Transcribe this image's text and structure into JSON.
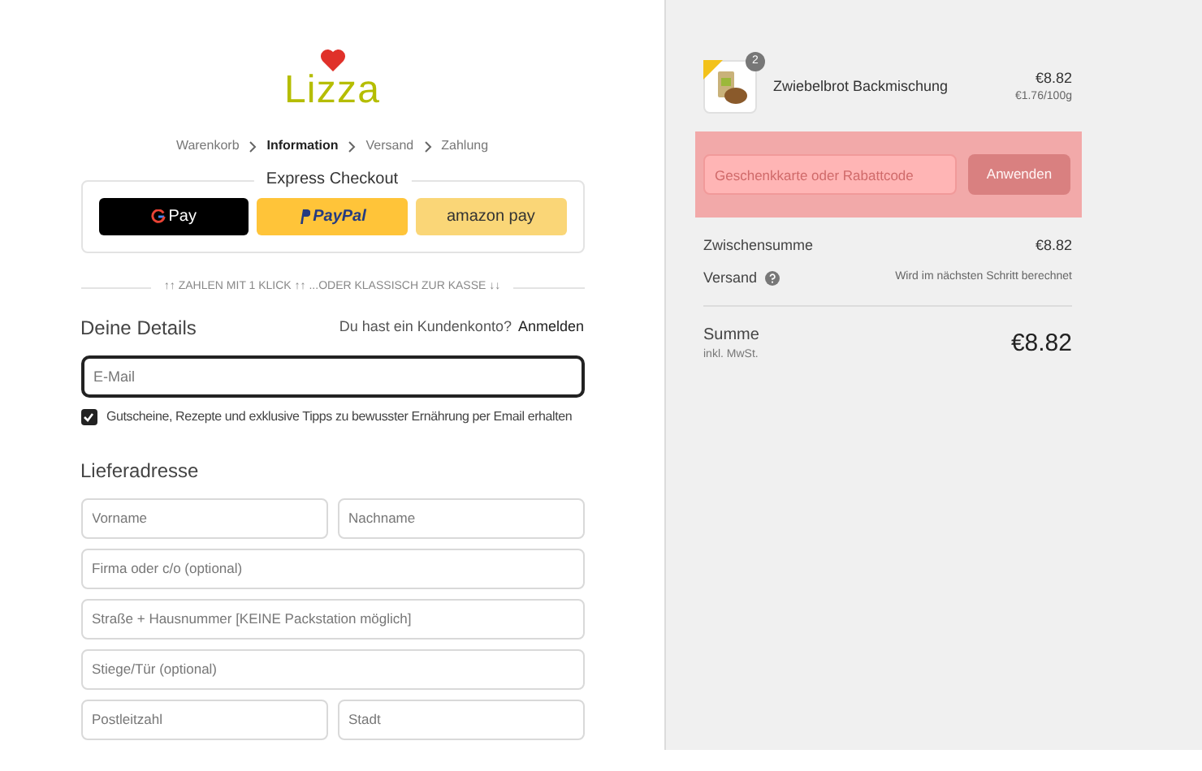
{
  "logo": {
    "text": "Lizza"
  },
  "breadcrumb": [
    {
      "label": "Warenkorb",
      "selected": false
    },
    {
      "label": "Information",
      "selected": true
    },
    {
      "label": "Versand",
      "selected": false
    },
    {
      "label": "Zahlung",
      "selected": false
    }
  ],
  "express_checkout": {
    "title": "Express Checkout",
    "buttons": [
      {
        "kind": "gpay",
        "label": "Pay"
      },
      {
        "kind": "paypal",
        "label": "PayPal"
      },
      {
        "kind": "amazon",
        "label": "amazon pay"
      }
    ]
  },
  "divider_text": "↑↑ ZAHLEN MIT 1 KLICK ↑↑ ...ODER KLASSISCH ZUR KASSE ↓↓",
  "details": {
    "title": "Deine Details",
    "account_prompt": "Du hast ein Kundenkonto?",
    "login_link": "Anmelden",
    "email": {
      "placeholder": "E-Mail",
      "focused": true
    },
    "newsletter": {
      "label": "Gutscheine, Rezepte und exklusive Tipps zu bewusster Ernährung per Email erhalten",
      "checked": true
    }
  },
  "shipping": {
    "title": "Lieferadresse",
    "rows": [
      [
        {
          "placeholder": "Vorname"
        },
        {
          "placeholder": "Nachname"
        }
      ],
      [
        {
          "placeholder": "Firma oder c/o (optional)"
        }
      ],
      [
        {
          "placeholder": "Straße + Hausnummer [KEINE Packstation möglich]"
        }
      ],
      [
        {
          "placeholder": "Stiege/Tür (optional)"
        }
      ],
      [
        {
          "placeholder": "Postleitzahl"
        },
        {
          "placeholder": "Stadt"
        }
      ]
    ]
  },
  "order": {
    "item": {
      "name": "Zwiebelbrot Backmischung",
      "quantity": "2",
      "price": "€8.82",
      "unit_price": "€1.76/100g"
    },
    "discount": {
      "placeholder": "Geschenkkarte oder Rabattcode",
      "button": "Anwenden"
    },
    "subtotal_label": "Zwischensumme",
    "subtotal": "€8.82",
    "shipping_label": "Versand",
    "shipping_note": "Wird im nächsten Schritt berechnet",
    "total_label": "Summe",
    "tax_note": "inkl. MwSt.",
    "total": "€8.82"
  }
}
